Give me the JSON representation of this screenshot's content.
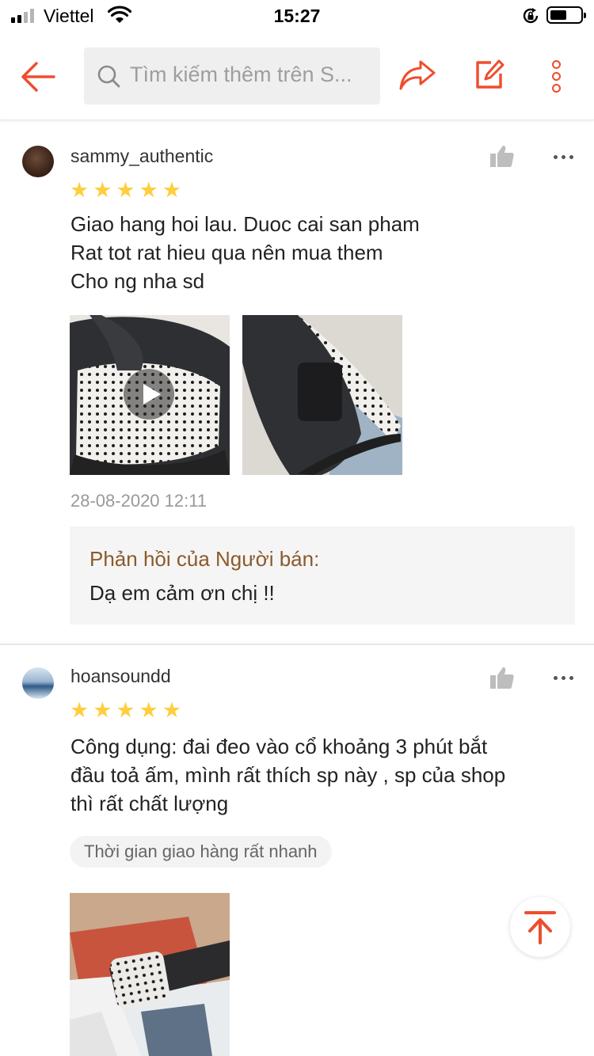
{
  "status_bar": {
    "carrier": "Viettel",
    "time": "15:27",
    "signal_icon": "signal-bars-icon",
    "wifi_icon": "wifi-icon",
    "orientation_lock_icon": "orientation-lock-icon",
    "battery_icon": "battery-icon",
    "battery_level": 0.5
  },
  "nav": {
    "back_icon": "arrow-left-icon",
    "search_placeholder": "Tìm kiếm thêm trên S...",
    "search_icon": "search-icon",
    "share_icon": "share-arrow-icon",
    "edit_icon": "edit-icon",
    "more_icon": "vertical-dots-icon",
    "accent_color": "#ee4d2d"
  },
  "reviews": [
    {
      "username": "sammy_authentic",
      "rating": 5,
      "rating_stars": "★★★★★",
      "text_lines": [
        "Giao hang hoi lau. Duoc cai san pham",
        "Rat tot rat hieu qua nên mua them",
        "Cho ng nha sd"
      ],
      "media": [
        {
          "kind": "video",
          "icon": "play-icon"
        },
        {
          "kind": "image"
        }
      ],
      "time": "28-08-2020 12:11",
      "seller_reply": {
        "label": "Phản hồi của Người bán:",
        "message": "Dạ em cảm ơn chị !!"
      }
    },
    {
      "username": "hoansoundd",
      "rating": 5,
      "rating_stars": "★★★★★",
      "text_lines": [
        "Công dụng: đai đeo vào cổ khoảng 3 phút bắt",
        "đầu toả ấm, mình rất thích sp này , sp của shop",
        "thì rất chất lượng"
      ],
      "tag": "Thời gian giao hàng rất nhanh",
      "media": [
        {
          "kind": "image"
        }
      ]
    }
  ],
  "star_color": "#ffce3d",
  "scroll_top_icon": "arrow-up-to-top-icon"
}
